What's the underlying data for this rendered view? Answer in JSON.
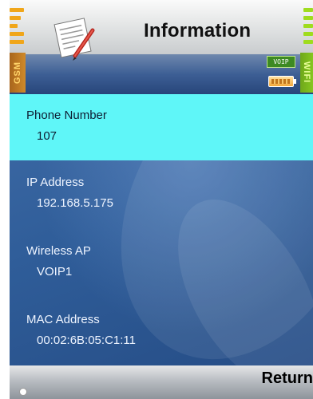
{
  "header": {
    "title": "Information",
    "gsm_label": "GSM",
    "wifi_label": "WIFI",
    "voip_badge": "VOIP"
  },
  "fields": [
    {
      "label": "Phone Number",
      "value": "107",
      "selected": true
    },
    {
      "label": "IP Address",
      "value": "192.168.5.175",
      "selected": false
    },
    {
      "label": "Wireless AP",
      "value": "VOIP1",
      "selected": false
    },
    {
      "label": "MAC Address",
      "value": "00:02:6B:05:C1:11",
      "selected": false
    }
  ],
  "footer": {
    "return_label": "Return"
  },
  "colors": {
    "selection": "#5ff6f8",
    "gsm": "#f0a61a",
    "wifi": "#9fdc1e",
    "background": "#2a5a93"
  },
  "icons": [
    "document-pen-icon",
    "gsm-signal-icon",
    "wifi-signal-icon",
    "battery-icon"
  ]
}
